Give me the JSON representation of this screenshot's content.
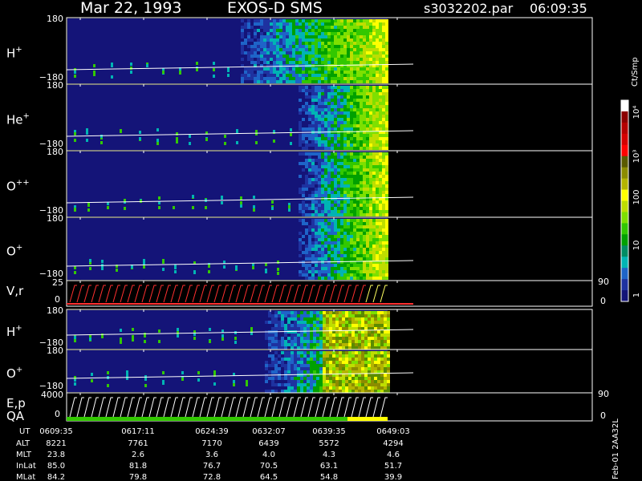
{
  "header": {
    "date": "Mar 22, 1993",
    "instrument": "EXOS-D SMS",
    "file": "s3032202.par",
    "time": "06:09:35"
  },
  "panels": [
    {
      "label": "H",
      "sup": "+",
      "ytop": "180",
      "ybot": "−180",
      "kind": "spec",
      "style": "a"
    },
    {
      "label": "He",
      "sup": "+",
      "ytop": "180",
      "ybot": "−180",
      "kind": "spec",
      "style": "b"
    },
    {
      "label": "O",
      "sup": "++",
      "ytop": "180",
      "ybot": "−180",
      "kind": "spec",
      "style": "b"
    },
    {
      "label": "O",
      "sup": "+",
      "ytop": "180",
      "ybot": "−180",
      "kind": "spec",
      "style": "b"
    },
    {
      "label": "V,r",
      "sup": "",
      "ytop": "25",
      "ybot": "0",
      "rtop": "90",
      "rbot": "0",
      "kind": "line",
      "style": "vr"
    },
    {
      "label": "H",
      "sup": "+",
      "ytop": "180",
      "ybot": "−180",
      "kind": "spec",
      "style": "c"
    },
    {
      "label": "O",
      "sup": "+",
      "ytop": "180",
      "ybot": "−180",
      "kind": "spec",
      "style": "c"
    },
    {
      "label": "E,p",
      "sub": "QA",
      "sup": "",
      "ytop": "4000",
      "ybot": "0",
      "rtop": "90",
      "rbot": "0",
      "kind": "line",
      "style": "ep"
    }
  ],
  "colorbar": {
    "unit": "Ct/Smp",
    "ticks": [
      "10⁴",
      "10³",
      "100",
      "10",
      "1"
    ],
    "colors": [
      "#ffffff",
      "#8c0000",
      "#b40000",
      "#d40000",
      "#ff0000",
      "#5a5a00",
      "#8c8c00",
      "#b4b400",
      "#ffff00",
      "#bede00",
      "#7ee000",
      "#32c800",
      "#00a000",
      "#008c64",
      "#00b4b4",
      "#1e64c8",
      "#1e32a0",
      "#141478"
    ]
  },
  "colors": {
    "bg": "#000000",
    "cold": "#141478"
  },
  "footer": {
    "ut_label": "UT",
    "ut": [
      "0609:35",
      "0617:11",
      "0624:39",
      "0632:07",
      "0639:35",
      "0649:03"
    ],
    "rows": [
      {
        "label": "ALT",
        "values": [
          "8221",
          "7761",
          "7170",
          "6439",
          "5572",
          "4294"
        ]
      },
      {
        "label": "MLT",
        "values": [
          "23.8",
          "2.6",
          "3.6",
          "4.0",
          "4.3",
          "4.6"
        ]
      },
      {
        "label": "InLat",
        "values": [
          "85.0",
          "81.8",
          "76.7",
          "70.5",
          "63.1",
          "51.7"
        ]
      },
      {
        "label": "MLat",
        "values": [
          "84.2",
          "79.8",
          "72.8",
          "64.5",
          "54.8",
          "39.9"
        ]
      }
    ]
  },
  "side_note": "Feb-01 2AA32L",
  "chart_data": {
    "type": "heatmap",
    "title": "Mar 22, 1993   EXOS-D SMS",
    "x_ticks": [
      "0609:35",
      "0617:11",
      "0624:39",
      "0632:07",
      "0639:35",
      "0649:03"
    ],
    "panels": [
      "H+",
      "He+",
      "O++",
      "O+",
      "V,r",
      "H+",
      "O+",
      "E,p QA"
    ],
    "ylim_spectrogram": [
      -180,
      180
    ],
    "vr_left_range": [
      0,
      25
    ],
    "vr_right_range": [
      0,
      90
    ],
    "ep_left_range": [
      0,
      4000
    ],
    "ep_right_range": [
      0,
      90
    ],
    "colorbar_unit": "Ct/Smp",
    "colorbar_ticks": [
      "1",
      "10",
      "100",
      "10³",
      "10⁴"
    ],
    "data_extent_fraction": 0.61
  }
}
